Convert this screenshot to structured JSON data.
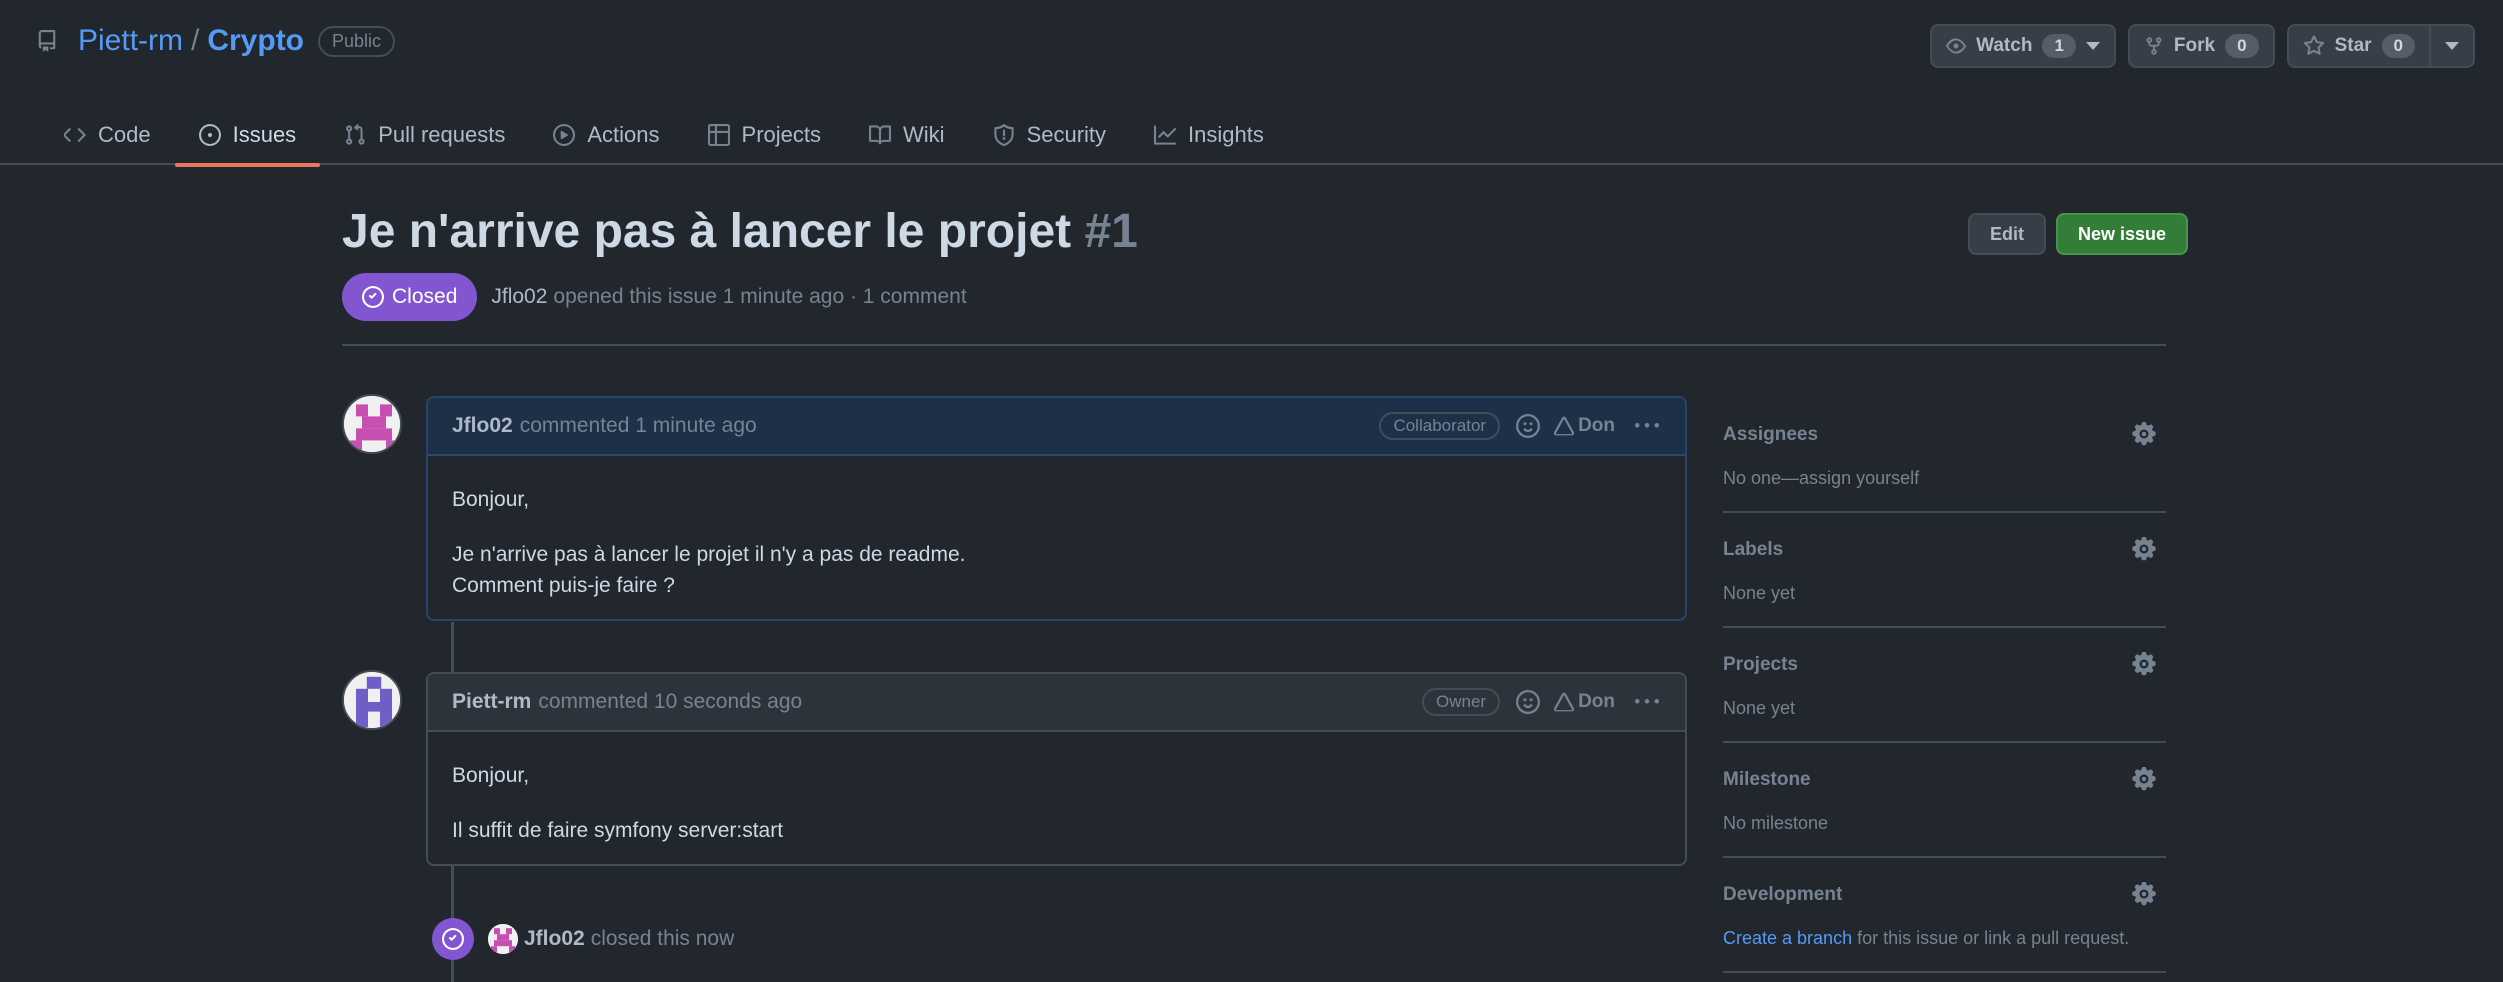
{
  "repo": {
    "owner": "Piett-rm",
    "slash": "/",
    "name": "Crypto",
    "visibility": "Public"
  },
  "actions": {
    "watch_label": "Watch",
    "watch_count": "1",
    "fork_label": "Fork",
    "fork_count": "0",
    "star_label": "Star",
    "star_count": "0"
  },
  "tabs": [
    {
      "label": "Code",
      "icon": "code-icon"
    },
    {
      "label": "Issues",
      "icon": "issue-opened-icon",
      "active": true
    },
    {
      "label": "Pull requests",
      "icon": "git-pull-request-icon"
    },
    {
      "label": "Actions",
      "icon": "play-icon"
    },
    {
      "label": "Projects",
      "icon": "table-icon"
    },
    {
      "label": "Wiki",
      "icon": "book-icon"
    },
    {
      "label": "Security",
      "icon": "shield-icon"
    },
    {
      "label": "Insights",
      "icon": "graph-icon"
    }
  ],
  "issue": {
    "title": "Je n'arrive pas à lancer le projet",
    "number": "#1",
    "edit_label": "Edit",
    "new_label": "New issue",
    "state": "Closed",
    "author": "Jflo02",
    "opened_text": "opened this issue 1 minute ago · 1 comment"
  },
  "comments": [
    {
      "author": "Jflo02",
      "time": "commented 1 minute ago",
      "role": "Collaborator",
      "tag": "Don",
      "body": [
        "Bonjour,",
        "Je n'arrive pas à lancer le projet il n'y a pas de readme.",
        "Comment puis-je faire ?"
      ]
    },
    {
      "author": "Piett-rm",
      "time": "commented 10 seconds ago",
      "role": "Owner",
      "tag": "Don",
      "body": [
        "Bonjour,",
        "Il suffit de faire symfony server:start"
      ]
    }
  ],
  "closed_event": {
    "author": "Jflo02",
    "text": "closed this now"
  },
  "sidebar": {
    "assignees": {
      "title": "Assignees",
      "value": "No one—assign yourself"
    },
    "labels": {
      "title": "Labels",
      "value": "None yet"
    },
    "projects": {
      "title": "Projects",
      "value": "None yet"
    },
    "milestone": {
      "title": "Milestone",
      "value": "No milestone"
    },
    "development": {
      "title": "Development",
      "link": "Create a branch",
      "value": "for this issue or link a pull request."
    }
  },
  "colors": {
    "background": "#22272e",
    "accent_link": "#539bf5",
    "closed_purple": "#8256d0",
    "new_issue_green": "#347d39",
    "active_tab_underline": "#ec775c"
  }
}
